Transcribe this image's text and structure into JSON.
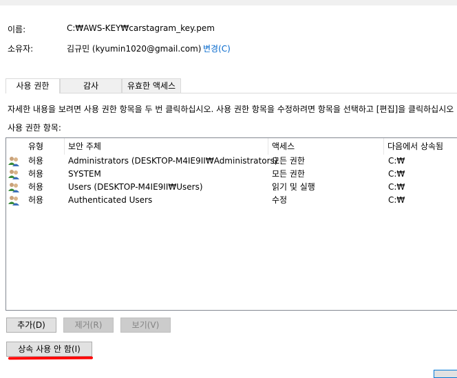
{
  "properties": {
    "name_label": "이름:",
    "name_value": "C:₩AWS-KEY₩carstagram_key.pem",
    "owner_label": "소유자:",
    "owner_value": "김규민 (kyumin1020@gmail.com)",
    "change_link": "변경(C)"
  },
  "tabs": [
    {
      "label": "사용 권한",
      "active": true
    },
    {
      "label": "감사",
      "active": false
    },
    {
      "label": "유효한 액세스",
      "active": false
    }
  ],
  "instruction": "자세한 내용을 보려면 사용 권한 항목을 두 번 클릭하십시오. 사용 권한 항목을 수정하려면 항목을 선택하고 [편집]을 클릭하십시오",
  "entries_label": "사용 권한 항목:",
  "columns": [
    "유형",
    "보안 주체",
    "액세스",
    "다음에서 상속됨"
  ],
  "rows": [
    {
      "type": "허용",
      "principal": "Administrators (DESKTOP-M4IE9II₩Administrators)",
      "access": "모든 권한",
      "inherited": "C:₩"
    },
    {
      "type": "허용",
      "principal": "SYSTEM",
      "access": "모든 권한",
      "inherited": "C:₩"
    },
    {
      "type": "허용",
      "principal": "Users (DESKTOP-M4IE9II₩Users)",
      "access": "읽기 및 실행",
      "inherited": "C:₩"
    },
    {
      "type": "허용",
      "principal": "Authenticated Users",
      "access": "수정",
      "inherited": "C:₩"
    }
  ],
  "buttons": {
    "add": "추가(D)",
    "remove": "제거(R)",
    "view": "보기(V)",
    "disable_inheritance": "상속 사용 안 함(I)"
  },
  "colors": {
    "link": "#0066cc",
    "annotation": "#ff0000"
  }
}
